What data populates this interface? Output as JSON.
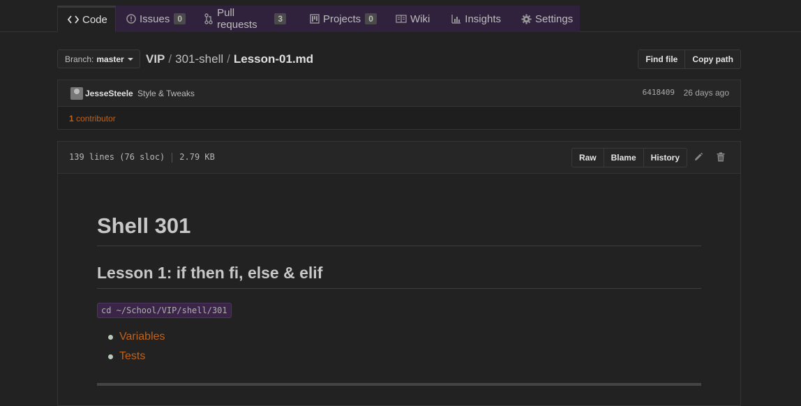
{
  "tabs": [
    {
      "label": "Code",
      "icon": "code-icon"
    },
    {
      "label": "Issues",
      "count": "0",
      "icon": "issue-icon"
    },
    {
      "label": "Pull requests",
      "count": "3",
      "icon": "pull-request-icon"
    },
    {
      "label": "Projects",
      "count": "0",
      "icon": "project-icon"
    },
    {
      "label": "Wiki",
      "icon": "book-icon"
    },
    {
      "label": "Insights",
      "icon": "graph-icon"
    },
    {
      "label": "Settings",
      "icon": "gear-icon"
    }
  ],
  "branch": {
    "prefix": "Branch:",
    "name": "master"
  },
  "breadcrumb": {
    "repo": "VIP",
    "sep1": "/",
    "dir": "301-shell",
    "sep2": "/",
    "file": "Lesson-01.md"
  },
  "file_buttons": {
    "find_file": "Find file",
    "copy_path": "Copy path"
  },
  "commit": {
    "author": "JesseSteele",
    "message": "Style & Tweaks",
    "sha": "6418409",
    "ago": "26 days ago",
    "contributors_count": "1",
    "contributors_label": "contributor"
  },
  "file_info": {
    "lines": "139 lines (76 sloc)",
    "size": "2.79 KB"
  },
  "file_actions": {
    "raw": "Raw",
    "blame": "Blame",
    "history": "History"
  },
  "readme": {
    "h1": "Shell 301",
    "h2": "Lesson 1: if then fi, else & elif",
    "code": "cd ~/School/VIP/shell/301",
    "links": [
      "Variables",
      "Tests"
    ]
  },
  "colors": {
    "accent": "#c0621a",
    "tab_band": "#30213d",
    "background": "#222222"
  }
}
